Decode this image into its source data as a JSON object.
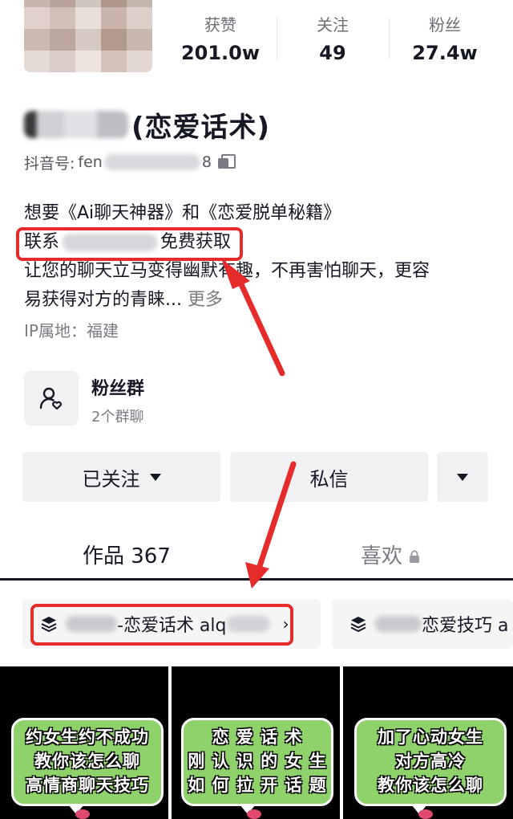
{
  "profile": {
    "stats": [
      {
        "label": "获赞",
        "value": "201.0w"
      },
      {
        "label": "关注",
        "value": "49"
      },
      {
        "label": "粉丝",
        "value": "27.4w"
      }
    ],
    "name_suffix": "(恋爱话术)",
    "douyin_id_label": "抖音号:",
    "douyin_id_prefix": "fen",
    "douyin_id_suffix": "8"
  },
  "bio": {
    "line1": "想要《Ai聊天神器》和《恋爱脱单秘籍》",
    "line2_prefix": "联系",
    "line2_suffix": "免费获取",
    "line3": "让您的聊天立马变得幽默有趣，不再害怕聊天，更容",
    "line4": "易获得对方的青睐...",
    "more": "更多"
  },
  "ip_location": "IP属地：福建",
  "fan_group": {
    "title": "粉丝群",
    "subtitle": "2个群聊"
  },
  "buttons": {
    "follow": "已关注",
    "message": "私信"
  },
  "tabs": {
    "works": "作品 367",
    "likes": "喜欢"
  },
  "collections": [
    {
      "text_before": "",
      "text": "-恋爱话术 alq"
    },
    {
      "text": "恋爱技巧 a"
    }
  ],
  "thumbnails": [
    {
      "lines": [
        "约女生约不成功",
        "教你该怎么聊",
        "高情商聊天技巧"
      ]
    },
    {
      "lines": [
        "恋 爱 话 术",
        "刚 认 识 的 女 生",
        "如 何 拉 开 话 题"
      ]
    },
    {
      "lines": [
        "加了心动女生",
        "对方高冷",
        "教你该怎么聊"
      ]
    }
  ],
  "colors": {
    "annotation_red": "#e62b2b",
    "bubble_green": "#8fd16a",
    "button_gray": "#f1f1f3"
  },
  "icons": [
    "copy-icon",
    "fan-group-icon",
    "dropdown-triangle-icon",
    "lock-icon",
    "collection-stack-icon",
    "chevron-right-icon"
  ]
}
